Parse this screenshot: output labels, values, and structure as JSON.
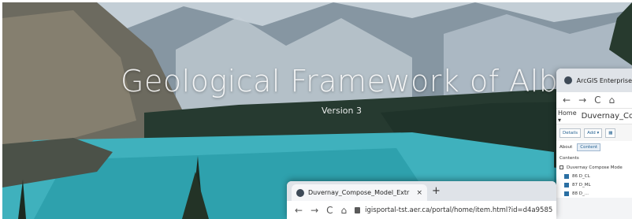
{
  "hero": {
    "title": "Geological Framework of Alberta",
    "version": "Version 3"
  },
  "window_right": {
    "tab_title": "ArcGIS Enterprise",
    "nav": {
      "back": "←",
      "forward": "→",
      "reload": "C",
      "home": "⌂"
    },
    "breadcrumb_home": "Home ▾",
    "breadcrumb_item": "Duvernay_Co",
    "toolbar": {
      "details": "Details",
      "add": "Add ▾",
      "more": "▦"
    },
    "tabs": {
      "about": "About",
      "content": "Content"
    },
    "contents_label": "Contents",
    "tree": {
      "root": "Duvernay Compose Mode",
      "items": [
        "86 D_CL",
        "87 D_ML",
        "88 D_..."
      ]
    }
  },
  "window_bottom": {
    "tab_title": "Duvernay_Compose_Model_Extr",
    "tab_close": "×",
    "new_tab": "+",
    "nav": {
      "back": "←",
      "forward": "→",
      "reload": "C",
      "home": "⌂"
    },
    "url": "igisportal-tst.aer.ca/portal/home/item.html?id=d4a9585"
  }
}
